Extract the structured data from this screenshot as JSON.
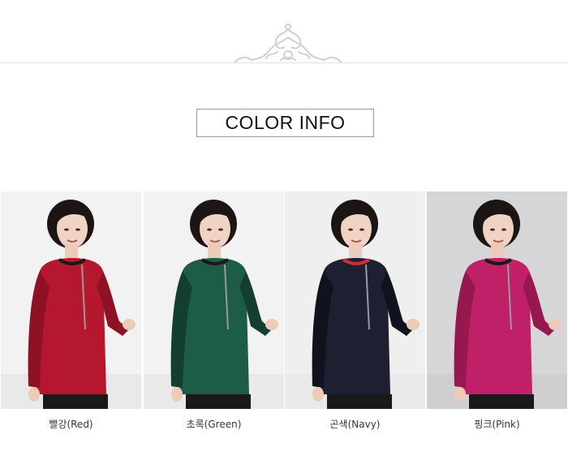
{
  "header": {
    "title": "COLOR INFO"
  },
  "colors": [
    {
      "label": "빨강(Red)",
      "shirt": "#b5182e",
      "shirt_dark": "#8e1224",
      "bg": "#f2f2f2"
    },
    {
      "label": "초록(Green)",
      "shirt": "#1d5c46",
      "shirt_dark": "#123f30",
      "bg": "#f2f2f2"
    },
    {
      "label": "곤색(Navy)",
      "shirt": "#1c2030",
      "shirt_dark": "#10131d",
      "bg": "#efefef"
    },
    {
      "label": "핑크(Pink)",
      "shirt": "#c02068",
      "shirt_dark": "#97184f",
      "bg": "#d6d6d8"
    }
  ]
}
